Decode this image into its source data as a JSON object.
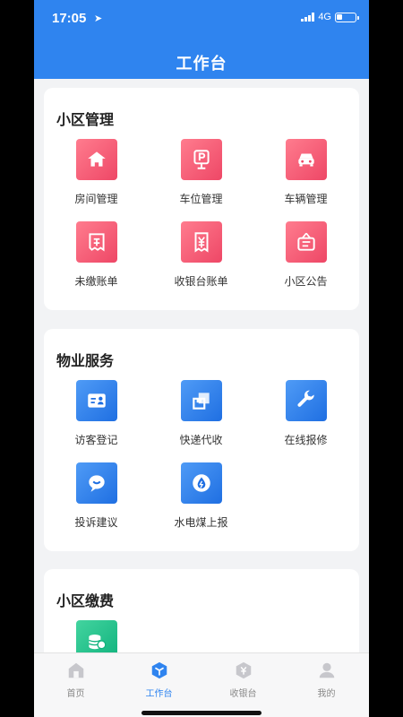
{
  "status_bar": {
    "time": "17:05",
    "network": "4G"
  },
  "header": {
    "title": "工作台"
  },
  "sections": [
    {
      "title": "小区管理",
      "items": [
        {
          "label": "房间管理",
          "icon": "house-icon"
        },
        {
          "label": "车位管理",
          "icon": "parking-icon"
        },
        {
          "label": "车辆管理",
          "icon": "car-icon"
        },
        {
          "label": "未缴账单",
          "icon": "unpaid-bill-icon"
        },
        {
          "label": "收银台账单",
          "icon": "cashier-bill-icon"
        },
        {
          "label": "小区公告",
          "icon": "announcement-icon"
        }
      ]
    },
    {
      "title": "物业服务",
      "items": [
        {
          "label": "访客登记",
          "icon": "visitor-card-icon"
        },
        {
          "label": "快递代收",
          "icon": "express-box-icon"
        },
        {
          "label": "在线报修",
          "icon": "wrench-icon"
        },
        {
          "label": "投诉建议",
          "icon": "chat-bubble-icon"
        },
        {
          "label": "水电煤上报",
          "icon": "water-drop-icon"
        }
      ]
    },
    {
      "title": "小区缴费",
      "items": [
        {
          "label": "",
          "icon": "coins-icon"
        }
      ]
    }
  ],
  "tabbar": [
    {
      "label": "首页",
      "icon": "home-icon",
      "active": false
    },
    {
      "label": "工作台",
      "icon": "workbench-cube-icon",
      "active": true
    },
    {
      "label": "收银台",
      "icon": "cashier-icon",
      "active": false
    },
    {
      "label": "我的",
      "icon": "profile-icon",
      "active": false
    }
  ],
  "colors": {
    "primary": "#2f84ef",
    "red_icon": "#ee4766",
    "blue_icon": "#1f6fe2",
    "green_icon": "#10b27d"
  }
}
